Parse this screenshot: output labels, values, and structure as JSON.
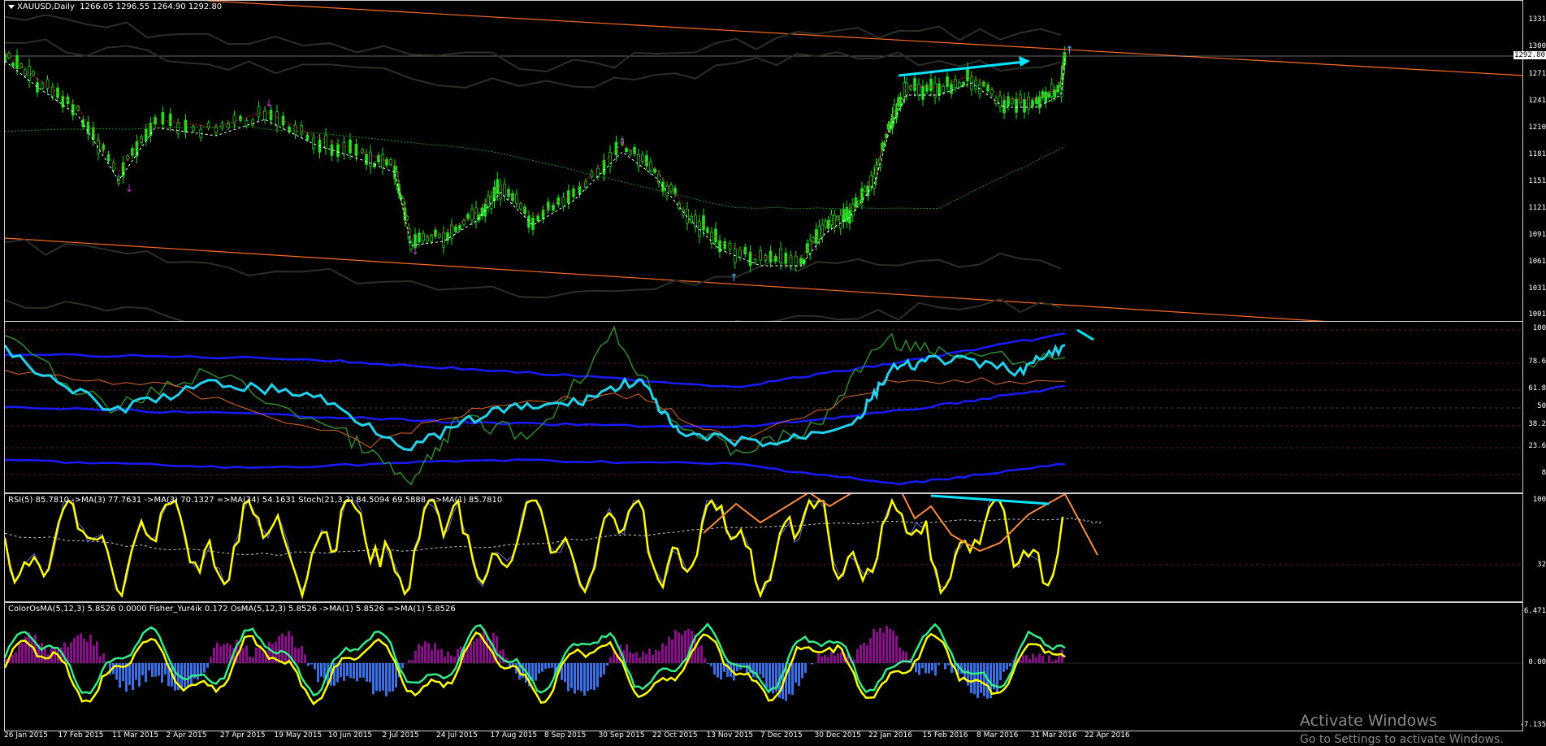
{
  "main": {
    "symbol": "XAUUSD,Daily",
    "ohlc": "1266.05 1296.55 1264.90 1292.80",
    "price_ticks": [
      "1331",
      "1300",
      "1292.80",
      "1271",
      "1241",
      "1210",
      "1181",
      "1151",
      "1121",
      "1091",
      "1061",
      "1031",
      "1001"
    ]
  },
  "pane2": {
    "levels": [
      "100",
      "78.6",
      "61.8",
      "50",
      "38.2",
      "23.6",
      "8"
    ]
  },
  "pane3": {
    "label": "RSI(5) 85.7810  ->MA(3) 77.7631  ->MA(3) 70.1327  =>MA(34) 54.1631  Stoch(21,3,3) 84.5094 69.5888  =>MA(1) 85.7810",
    "levels": [
      "100",
      "32"
    ]
  },
  "pane4": {
    "label": "ColorOsMA(5,12,3) 5.8526 0.0000  Fisher_Yur4ik 0.172  OsMA(5,12,3) 5.8526  ->MA(1) 5.8526  =>MA(1) 5.8526",
    "levels": [
      "6.471",
      "0.00",
      "-7.135"
    ]
  },
  "dates": [
    "26 Jan 2015",
    "17 Feb 2015",
    "11 Mar 2015",
    "2 Apr 2015",
    "27 Apr 2015",
    "19 May 2015",
    "10 Jun 2015",
    "2 Jul 2015",
    "24 Jul 2015",
    "17 Aug 2015",
    "8 Sep 2015",
    "30 Sep 2015",
    "22 Oct 2015",
    "13 Nov 2015",
    "7 Dec 2015",
    "30 Dec 2015",
    "22 Jan 2016",
    "15 Feb 2016",
    "8 Mar 2016",
    "31 Mar 2016",
    "22 Apr 2016"
  ],
  "watermark": {
    "line1": "Activate Windows",
    "line2": "Go to Settings to activate Windows."
  },
  "colors": {
    "candle": "#22dd22",
    "channel": "#ff6a20",
    "rsi": "#ffff00",
    "arrow_cyan": "#00e5ff",
    "arrow_orange": "#ff8c40",
    "blue_band": "#1a1aff",
    "osma_pos": "#8a108a",
    "osma_neg": "#3c6ee6",
    "fisher": "#33ee88"
  },
  "icons": [
    "dropdown-triangle-icon"
  ]
}
